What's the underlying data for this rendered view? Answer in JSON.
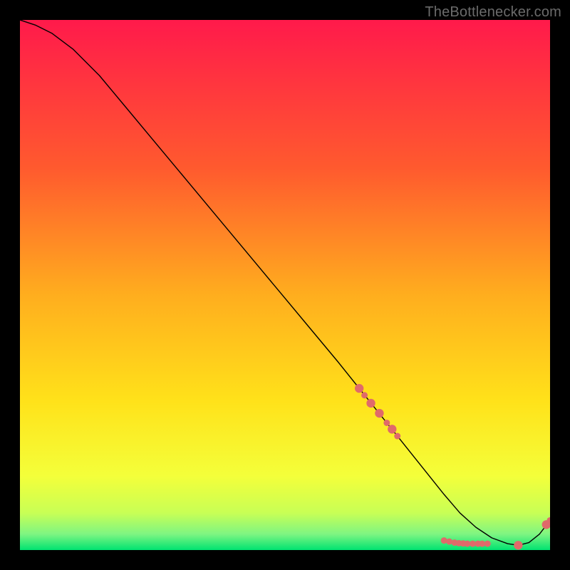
{
  "attribution": "TheBottlenecker.com",
  "chart_data": {
    "type": "line",
    "title": "",
    "xlabel": "",
    "ylabel": "",
    "xlim": [
      0,
      100
    ],
    "ylim": [
      0,
      100
    ],
    "background_gradient_top": "#ff1a4b",
    "background_gradient_mid": "#ffd21a",
    "background_gradient_low": "#e7ff4a",
    "background_gradient_green": "#00e371",
    "outer_background": "#000000",
    "series": [
      {
        "name": "bottleneck-curve",
        "color": "#000000",
        "stroke_width": 1.4,
        "x": [
          0,
          3,
          6,
          10,
          15,
          20,
          25,
          30,
          35,
          40,
          45,
          50,
          55,
          60,
          64,
          68,
          72,
          76,
          80,
          83,
          86,
          89,
          92,
          94,
          96,
          98,
          100
        ],
        "y": [
          100,
          99,
          97.5,
          94.5,
          89.5,
          83.5,
          77.5,
          71.5,
          65.5,
          59.5,
          53.5,
          47.5,
          41.5,
          35.5,
          30.5,
          25.5,
          20.5,
          15.5,
          10.5,
          7,
          4.3,
          2.3,
          1.2,
          0.9,
          1.4,
          3.0,
          5.6
        ]
      }
    ],
    "markers": {
      "name": "sample-points",
      "color": "#e06a6a",
      "radius_small": 4.5,
      "radius_large": 6.2,
      "points": [
        {
          "x": 64.0,
          "y": 30.5,
          "r": "large"
        },
        {
          "x": 65.0,
          "y": 29.2,
          "r": "small"
        },
        {
          "x": 66.2,
          "y": 27.7,
          "r": "large"
        },
        {
          "x": 67.8,
          "y": 25.8,
          "r": "large"
        },
        {
          "x": 69.2,
          "y": 24.0,
          "r": "small"
        },
        {
          "x": 70.2,
          "y": 22.8,
          "r": "large"
        },
        {
          "x": 71.2,
          "y": 21.5,
          "r": "small"
        },
        {
          "x": 80.0,
          "y": 1.8,
          "r": "small"
        },
        {
          "x": 81.0,
          "y": 1.6,
          "r": "small"
        },
        {
          "x": 82.0,
          "y": 1.4,
          "r": "small"
        },
        {
          "x": 82.8,
          "y": 1.3,
          "r": "small"
        },
        {
          "x": 83.6,
          "y": 1.25,
          "r": "small"
        },
        {
          "x": 84.4,
          "y": 1.2,
          "r": "small"
        },
        {
          "x": 85.4,
          "y": 1.2,
          "r": "small"
        },
        {
          "x": 86.4,
          "y": 1.2,
          "r": "small"
        },
        {
          "x": 87.2,
          "y": 1.2,
          "r": "small"
        },
        {
          "x": 88.2,
          "y": 1.2,
          "r": "small"
        },
        {
          "x": 94.0,
          "y": 0.9,
          "r": "large"
        },
        {
          "x": 99.3,
          "y": 4.8,
          "r": "large"
        },
        {
          "x": 100.0,
          "y": 5.6,
          "r": "small"
        }
      ]
    }
  }
}
